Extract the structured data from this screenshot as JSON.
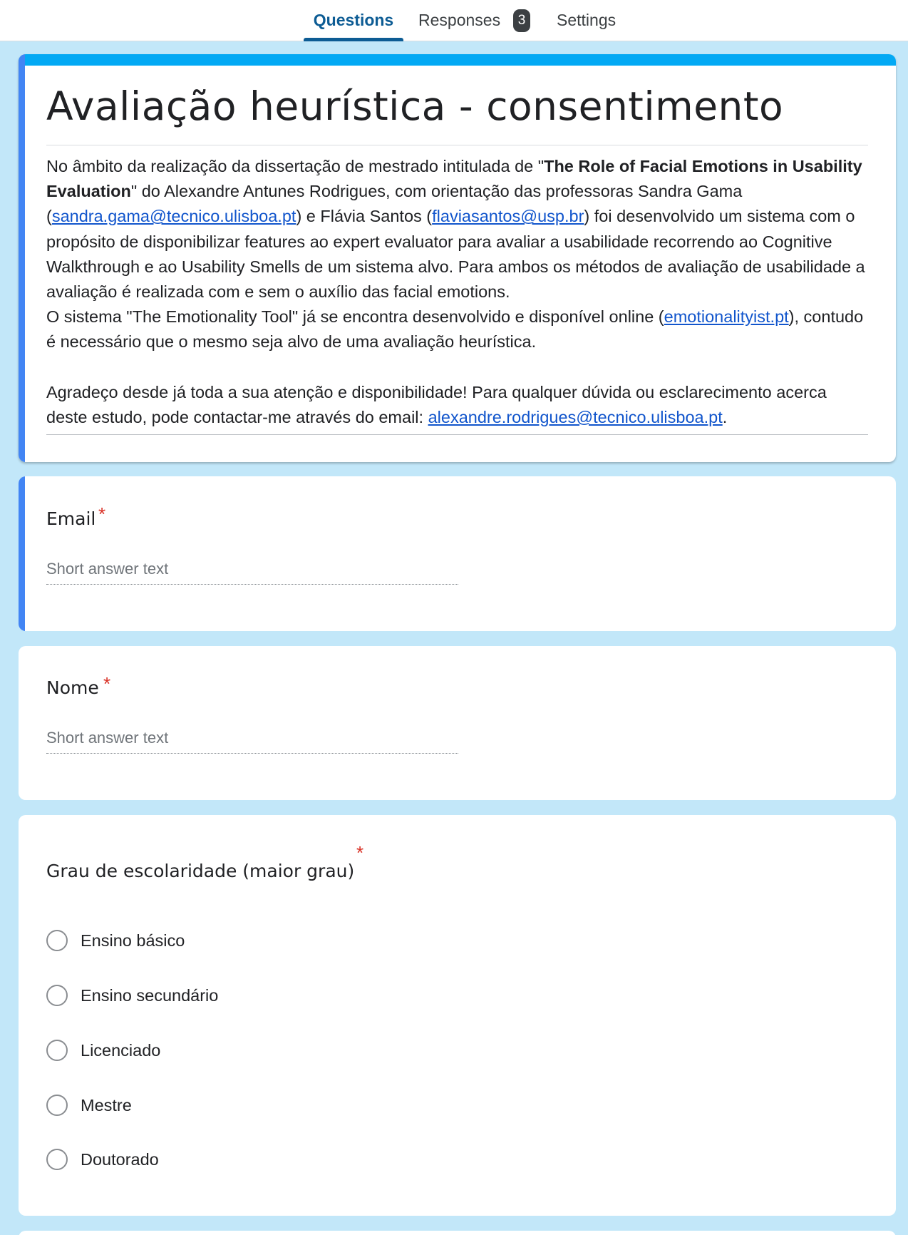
{
  "tabs": {
    "questions": "Questions",
    "responses": "Responses",
    "responses_count": "3",
    "settings": "Settings"
  },
  "colors": {
    "background": "#c2e7f9",
    "accent_top": "#03a9f4",
    "accent_left": "#4285f4",
    "active_tab": "#0d5c94",
    "required": "#d93025",
    "link": "#1155cc"
  },
  "form": {
    "title": "Avaliação heurística - consentimento",
    "description": {
      "p1_a": "No âmbito da realização da dissertação de mestrado intitulada de \"",
      "p1_bold": "The Role of Facial Emotions in Usability Evaluation",
      "p1_b": "\" do Alexandre Antunes Rodrigues, com orientação das professoras Sandra Gama (",
      "email_sandra": "sandra.gama@tecnico.ulisboa.pt",
      "p1_c": ") e Flávia Santos (",
      "email_flavia": "flaviasantos@usp.br",
      "p1_d": ") foi desenvolvido um sistema com o propósito de disponibilizar features ao expert evaluator para avaliar a usabilidade recorrendo ao Cognitive Walkthrough e ao Usability Smells de um sistema alvo. Para ambos os métodos de avaliação de usabilidade a avaliação é realizada com e sem o auxílio das facial emotions.",
      "p2_a": "O sistema \"The Emotionality Tool\" já se encontra desenvolvido e disponível online (",
      "site": "emotionalityist.pt",
      "p2_b": "), contudo é necessário que o mesmo seja alvo de uma avaliação heurística.",
      "p3_a": "Agradeço desde já toda a sua atenção e disponibilidade! Para qualquer dúvida ou esclarecimento acerca deste estudo, pode contactar-me através do email: ",
      "email_alexandre": "alexandre.rodrigues@tecnico.ulisboa.pt",
      "p3_b": "."
    }
  },
  "questions": [
    {
      "title": "Email",
      "required_mark": "*",
      "placeholder": "Short answer text"
    },
    {
      "title": "Nome",
      "required_mark": "*",
      "placeholder": "Short answer text"
    },
    {
      "title": "Grau de escolaridade (maior grau)",
      "required_mark": "*",
      "options": [
        "Ensino básico",
        "Ensino secundário",
        "Licenciado",
        "Mestre",
        "Doutorado"
      ]
    }
  ]
}
